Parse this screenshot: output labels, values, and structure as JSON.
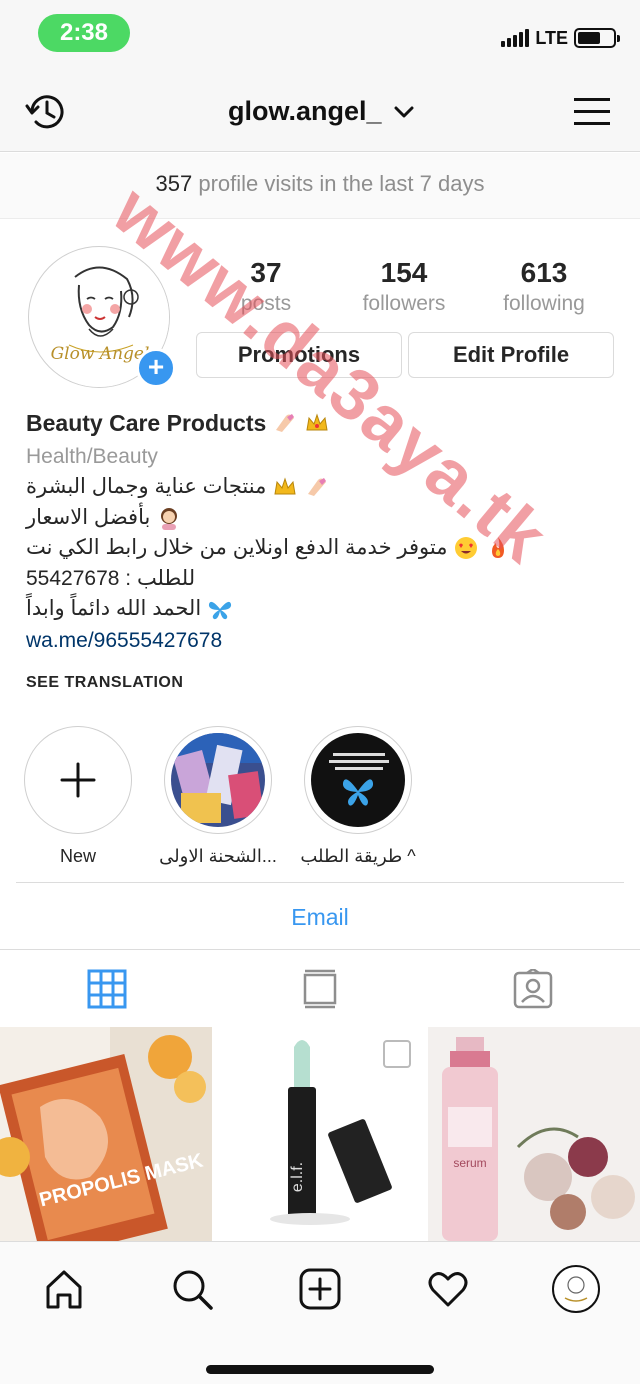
{
  "status_bar": {
    "time": "2:38",
    "network": "LTE"
  },
  "header": {
    "username": "glow.angel_"
  },
  "insights": {
    "visits_count": "357",
    "visits_text": "profile visits in the last 7 days"
  },
  "profile": {
    "stats": [
      {
        "count": "37",
        "label": "posts"
      },
      {
        "count": "154",
        "label": "followers"
      },
      {
        "count": "613",
        "label": "following"
      }
    ],
    "buttons": {
      "promotions": "Promotions",
      "edit_profile": "Edit Profile"
    },
    "avatar_text": "Glow Angel"
  },
  "bio": {
    "name": "Beauty Care Products",
    "category": "Health/Beauty",
    "lines": [
      "منتجات عناية وجمال البشرة",
      "بأفضل الاسعار",
      "متوفر خدمة الدفع اونلاين من خلال رابط الكي نت",
      "للطلب : 55427678",
      "الحمد الله دائماً وابداً"
    ],
    "link": "wa.me/96555427678",
    "see_translation": "SEE TRANSLATION"
  },
  "highlights": [
    {
      "label": "New"
    },
    {
      "label": "الشحنة الاولى..."
    },
    {
      "label": "طريقة الطلب ^"
    }
  ],
  "contact": {
    "email_label": "Email"
  },
  "tabs": {
    "active": "grid"
  },
  "posts": [
    {
      "caption": "PROPOLIS MASK"
    },
    {
      "caption": "e.l.f."
    },
    {
      "caption": "serum"
    }
  ],
  "watermark": "www.da3aya.tk",
  "colors": {
    "accent": "#3897f0",
    "status_green": "#4cd964",
    "link": "#003569",
    "watermark": "#e6505a"
  }
}
